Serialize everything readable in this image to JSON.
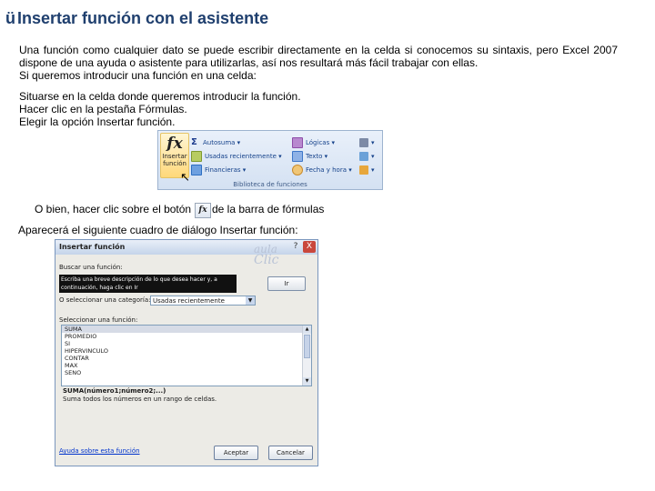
{
  "title": {
    "check": "ü",
    "text": "Insertar función con el asistente"
  },
  "intro": {
    "line1": "Una función como cualquier dato se puede escribir directamente en la celda si conocemos su sintaxis, pero Excel 2007",
    "line2": "dispone de una ayuda o asistente para utilizarlas, así nos resultará más fácil trabajar con ellas.",
    "line3": "Si queremos introducir una función en una celda:"
  },
  "steps": [
    "Situarse en la celda donde queremos introducir la función.",
    "Hacer clic en la pestaña Fórmulas.",
    "Elegir la opción Insertar función."
  ],
  "ribbon": {
    "fx_glyph": "fx",
    "fx_label_1": "Insertar",
    "fx_label_2": "función",
    "col1": [
      "Autosuma",
      "Usadas recientemente",
      "Financieras"
    ],
    "col2": [
      "Lógicas",
      "Texto",
      "Fecha y hora"
    ],
    "footer": "Biblioteca de funciones",
    "colors": {
      "autosuma": "#1d3c8e",
      "usadas": "#7e9a2e",
      "financieras": "#2d6fc2",
      "logicas": "#8e4da8",
      "texto": "#3e77c9",
      "fecha": "#c98b2c"
    }
  },
  "alt_text": {
    "before": "O bien, hacer clic sobre el botón",
    "button_glyph": "fx",
    "after": "de la barra de fórmulas"
  },
  "appear_text": "Aparecerá el siguiente cuadro de diálogo Insertar función:",
  "dialog": {
    "title": "Insertar función",
    "help": "?",
    "close": "X",
    "watermark_1": "aula",
    "watermark_2": "Clic",
    "search_label": "Buscar una función:",
    "search_value": "Escriba una breve descripción de lo que desea hacer y, a continuación, haga clic en Ir",
    "go_button": "Ir",
    "category_label": "O seleccionar una categoría:",
    "category_value": "Usadas recientemente",
    "list_label": "Seleccionar una función:",
    "functions": [
      "SUMA",
      "PROMEDIO",
      "SI",
      "HIPERVINCULO",
      "CONTAR",
      "MAX",
      "SENO"
    ],
    "signature": "SUMA(número1;número2;...)",
    "description": "Suma todos los números en un rango de celdas.",
    "help_link": "Ayuda sobre esta función",
    "ok_button": "Aceptar",
    "cancel_button": "Cancelar"
  }
}
